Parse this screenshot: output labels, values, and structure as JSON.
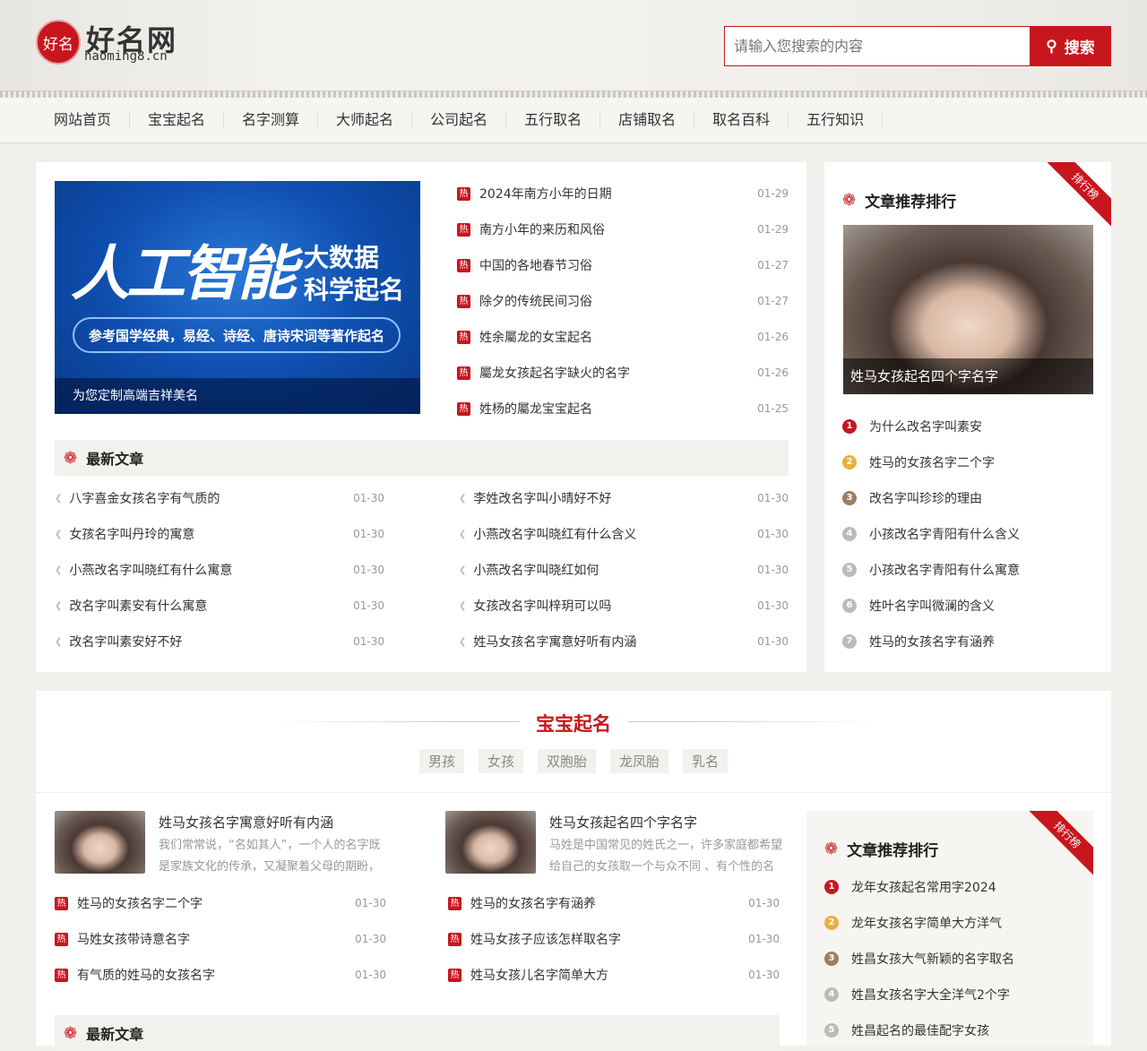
{
  "header": {
    "logo_seal": "好名",
    "logo_title": "好名网",
    "logo_sub": "haoming8.cn",
    "search_placeholder": "请输入您搜索的内容",
    "search_button": "搜索"
  },
  "nav": [
    "网站首页",
    "宝宝起名",
    "名字测算",
    "大师起名",
    "公司起名",
    "五行取名",
    "店铺取名",
    "取名百科",
    "五行知识"
  ],
  "banner": {
    "big": "人工智能",
    "r1": "大数据",
    "r2": "科学起名",
    "pill": "参考国学经典，易经、诗经、唐诗宋词等著作起名",
    "caption": "为您定制高端吉祥美名"
  },
  "hot_label": "热",
  "hot_list": [
    {
      "title": "2024年南方小年的日期",
      "date": "01-29"
    },
    {
      "title": "南方小年的来历和风俗",
      "date": "01-29"
    },
    {
      "title": "中国的各地春节习俗",
      "date": "01-27"
    },
    {
      "title": "除夕的传统民间习俗",
      "date": "01-27"
    },
    {
      "title": "姓余屬龙的女宝起名",
      "date": "01-26"
    },
    {
      "title": "屬龙女孩起名字缺火的名字",
      "date": "01-26"
    },
    {
      "title": "姓杨的屬龙宝宝起名",
      "date": "01-25"
    }
  ],
  "latest": {
    "title": "最新文章",
    "left": [
      {
        "title": "八字喜金女孩名字有气质的",
        "date": "01-30"
      },
      {
        "title": "女孩名字叫丹玲的寓意",
        "date": "01-30"
      },
      {
        "title": "小燕改名字叫晓红有什么寓意",
        "date": "01-30"
      },
      {
        "title": "改名字叫素安有什么寓意",
        "date": "01-30"
      },
      {
        "title": "改名字叫素安好不好",
        "date": "01-30"
      }
    ],
    "right": [
      {
        "title": "李姓改名字叫小晴好不好",
        "date": "01-30"
      },
      {
        "title": "小燕改名字叫晓红有什么含义",
        "date": "01-30"
      },
      {
        "title": "小燕改名字叫晓红如何",
        "date": "01-30"
      },
      {
        "title": "女孩改名字叫梓玥可以吗",
        "date": "01-30"
      },
      {
        "title": "姓马女孩名字寓意好听有内涵",
        "date": "01-30"
      }
    ]
  },
  "rank1": {
    "title": "文章推荐排行",
    "ribbon": "排行榜",
    "photo_caption": "姓马女孩起名四个字名字",
    "items": [
      "为什么改名字叫素安",
      "姓马的女孩名字二个字",
      "改名字叫珍珍的理由",
      "小孩改名字青阳有什么含义",
      "小孩改名字青阳有什么寓意",
      "姓叶名字叫微澜的含义",
      "姓马的女孩名字有涵养"
    ]
  },
  "rank_colors": [
    "#c8161e",
    "#e8b040",
    "#9a8060",
    "#bbbbbb",
    "#bbbbbb",
    "#bbbbbb",
    "#bbbbbb"
  ],
  "baby": {
    "title": "宝宝起名",
    "tags": [
      "男孩",
      "女孩",
      "双胞胎",
      "龙凤胎",
      "乳名"
    ],
    "cards": [
      {
        "title": "姓马女孩名字寓意好听有内涵",
        "desc": "我们常常说，“名如其人”，一个人的名字既是家族文化的传承，又凝聚着父母的期盼，"
      },
      {
        "title": "姓马女孩起名四个字名字",
        "desc": "马姓是中国常见的姓氏之一，许多家庭都希望给自己的女孩取一个与众不同 、有个性的名"
      }
    ],
    "left": [
      {
        "title": "姓马的女孩名字二个字",
        "date": "01-30"
      },
      {
        "title": "马姓女孩带诗意名字",
        "date": "01-30"
      },
      {
        "title": "有气质的姓马的女孩名字",
        "date": "01-30"
      }
    ],
    "right": [
      {
        "title": "姓马的女孩名字有涵养",
        "date": "01-30"
      },
      {
        "title": "姓马女孩子应该怎样取名字",
        "date": "01-30"
      },
      {
        "title": "姓马女孩儿名字简单大方",
        "date": "01-30"
      }
    ],
    "latest_title": "最新文章"
  },
  "rank2": {
    "title": "文章推荐排行",
    "ribbon": "排行榜",
    "items": [
      "龙年女孩起名常用字2024",
      "龙年女孩名字简单大方洋气",
      "姓昌女孩大气新颖的名字取名",
      "姓昌女孩名字大全洋气2个字",
      "姓昌起名的最佳配字女孩"
    ]
  }
}
